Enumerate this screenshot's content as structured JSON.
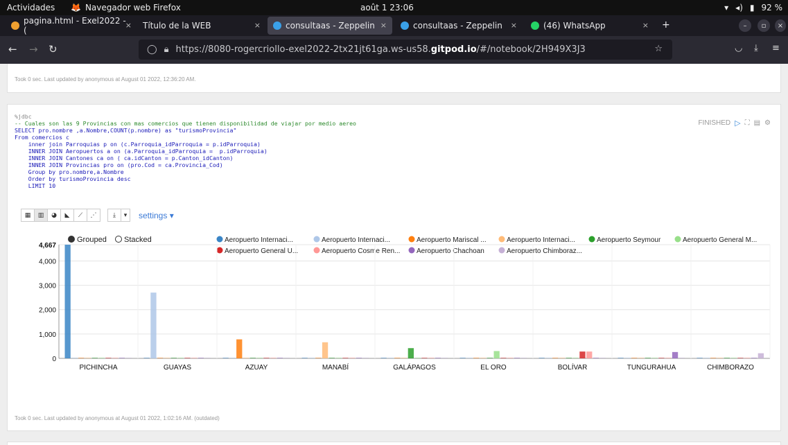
{
  "topbar": {
    "activities": "Actividades",
    "app_name": "Navegador web Firefox",
    "clock": "août 1  23:06",
    "battery": "92 %"
  },
  "tabs": [
    {
      "label": "pagina.html - Exel2022 - (",
      "close": "×"
    },
    {
      "label": "Título de la WEB",
      "close": "×"
    },
    {
      "label": "consultaas - Zeppelin",
      "close": "×"
    },
    {
      "label": "consultaas - Zeppelin",
      "close": "×"
    },
    {
      "label": "(46) WhatsApp",
      "close": "×"
    }
  ],
  "navbar": {
    "url_prefix": "https://8080-rogercriollo-exel2022-2tx21jt61ga.ws-us58.",
    "url_host": "gitpod.io",
    "url_suffix": "/#/notebook/2H949X3J3"
  },
  "paragraph1": {
    "status": "Took 0 sec. Last updated by anonymous at August 01 2022, 12:36:20 AM."
  },
  "paragraph2": {
    "code_lines": [
      "%jdbc",
      "-- Cuales son las 9 Provincias con mas comercios que tienen disponibilidad de viajar por medio aereo",
      "SELECT pro.nombre ,a.Nombre,COUNT(p.nombre) as \"turismoProvincia\"",
      "From comercios c",
      "    inner join Parroquias p on (c.Parroquia_idParroquia = p.idParroquia)",
      "    INNER JOIN Aeropuertos a on (a.Parroquia_idParroquia =  p.idParroquia)",
      "    INNER JOIN Cantones ca on ( ca.idCanton = p.Canton_idCanton)",
      "    INNER JOIN Provincias pro on (pro.Cod = ca.Provincia_Cod)",
      "    Group by pro.nombre,a.Nombre",
      "    Order by turismoProvincia desc",
      "    LIMIT 10"
    ],
    "state": "FINISHED",
    "settings_label": "settings ▾",
    "status": "Took 0 sec. Last updated by anonymous at August 01 2022, 1:02:16 AM. (outdated)"
  },
  "chart_data": {
    "type": "bar",
    "mode_options": [
      "Grouped",
      "Stacked"
    ],
    "selected_mode": "Grouped",
    "categories": [
      "PICHINCHA",
      "GUAYAS",
      "AZUAY",
      "MANABÍ",
      "GALÁPAGOS",
      "EL ORO",
      "BOLÍVAR",
      "TUNGURAHUA",
      "CHIMBORAZO"
    ],
    "y_ticks": [
      "0",
      "1,000",
      "2,000",
      "3,000",
      "4,000",
      "4,667"
    ],
    "ylim": [
      0,
      4667
    ],
    "grid": true,
    "legend_position": "top",
    "series": [
      {
        "name": "Aeropuerto Internaci...",
        "color": "#3a85c6",
        "values": [
          4667,
          0,
          0,
          0,
          0,
          0,
          0,
          0,
          0
        ]
      },
      {
        "name": "Aeropuerto Internaci...",
        "color": "#aec7e8",
        "values": [
          0,
          2700,
          0,
          0,
          0,
          0,
          0,
          0,
          0
        ]
      },
      {
        "name": "Aeropuerto Mariscal ...",
        "color": "#ff7f0e",
        "values": [
          0,
          0,
          780,
          0,
          0,
          0,
          0,
          0,
          0
        ]
      },
      {
        "name": "Aeropuerto Internaci...",
        "color": "#ffbb78",
        "values": [
          0,
          0,
          0,
          660,
          0,
          0,
          0,
          0,
          0
        ]
      },
      {
        "name": "Aeropuerto Seymour",
        "color": "#2ca02c",
        "values": [
          0,
          0,
          0,
          0,
          420,
          0,
          0,
          0,
          0
        ]
      },
      {
        "name": "Aeropuerto General M...",
        "color": "#98df8a",
        "values": [
          0,
          0,
          0,
          0,
          0,
          300,
          0,
          0,
          0
        ]
      },
      {
        "name": "Aeropuerto General U...",
        "color": "#d62728",
        "values": [
          0,
          0,
          0,
          0,
          0,
          0,
          280,
          0,
          0
        ]
      },
      {
        "name": "Aeropuerto Cosme Ren...",
        "color": "#ff9896",
        "values": [
          0,
          0,
          0,
          0,
          0,
          0,
          280,
          0,
          0
        ]
      },
      {
        "name": "Aeropuerto Chachoan",
        "color": "#9467bd",
        "values": [
          0,
          0,
          0,
          0,
          0,
          0,
          0,
          260,
          0
        ]
      },
      {
        "name": "Aeropuerto Chimboraz...",
        "color": "#c5b0d5",
        "values": [
          0,
          0,
          0,
          0,
          0,
          0,
          0,
          0,
          210
        ]
      }
    ]
  }
}
